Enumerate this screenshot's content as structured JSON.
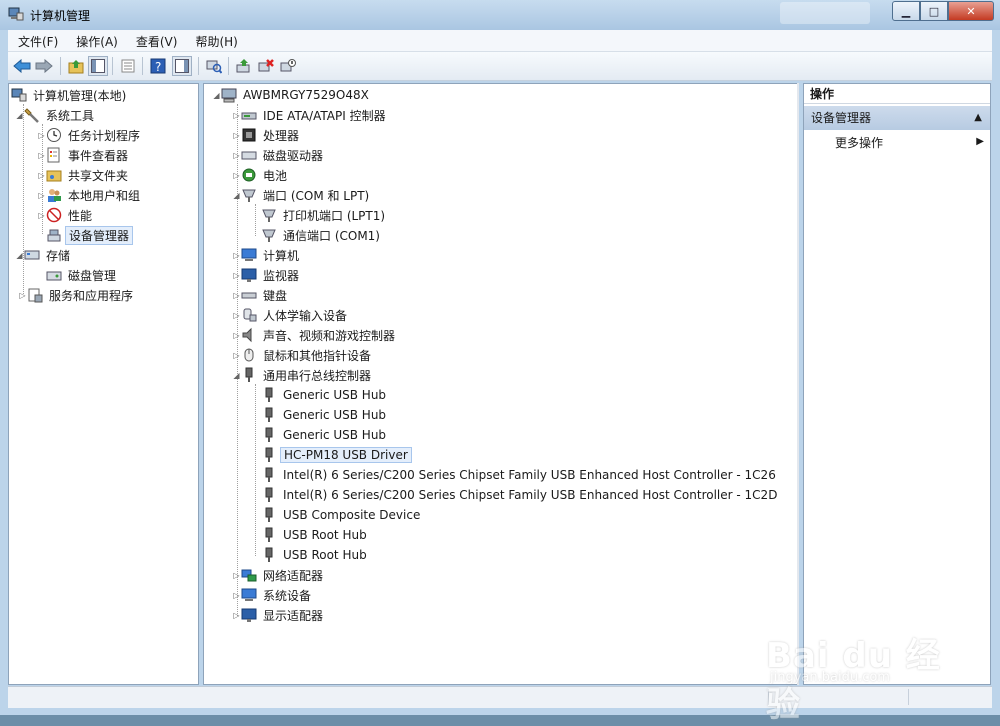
{
  "window": {
    "title": "计算机管理"
  },
  "menubar": {
    "items": [
      "文件(F)",
      "操作(A)",
      "查看(V)",
      "帮助(H)"
    ]
  },
  "left_tree": {
    "root": "计算机管理(本地)",
    "system_tools": "系统工具",
    "task_scheduler": "任务计划程序",
    "event_viewer": "事件查看器",
    "shared_folders": "共享文件夹",
    "local_users": "本地用户和组",
    "performance": "性能",
    "device_manager": "设备管理器",
    "storage": "存储",
    "disk_management": "磁盘管理",
    "services_apps": "服务和应用程序"
  },
  "device_tree": {
    "computer_name": "AWBMRGY7529O48X",
    "ide": "IDE ATA/ATAPI 控制器",
    "processor": "处理器",
    "disk_drives": "磁盘驱动器",
    "battery": "电池",
    "ports": "端口 (COM 和 LPT)",
    "printer_port": "打印机端口 (LPT1)",
    "comm_port": "通信端口 (COM1)",
    "computer": "计算机",
    "monitor": "监视器",
    "keyboard": "键盘",
    "hid": "人体学输入设备",
    "sound": "声音、视频和游戏控制器",
    "mouse": "鼠标和其他指针设备",
    "usb_controllers": "通用串行总线控制器",
    "usb_devices": [
      "Generic USB Hub",
      "Generic USB Hub",
      "Generic USB Hub",
      "HC-PM18 USB Driver",
      "Intel(R) 6 Series/C200 Series Chipset Family USB Enhanced Host Controller - 1C26",
      "Intel(R) 6 Series/C200 Series Chipset Family USB Enhanced Host Controller - 1C2D",
      "USB Composite Device",
      "USB Root Hub",
      "USB Root Hub"
    ],
    "network_adapters": "网络适配器",
    "system_devices": "系统设备",
    "display_adapters": "显示适配器"
  },
  "actions": {
    "header": "操作",
    "section": "设备管理器",
    "more": "更多操作"
  },
  "watermark": {
    "text": "Bai du 经验",
    "sub": "jingyan.baidu.com"
  }
}
